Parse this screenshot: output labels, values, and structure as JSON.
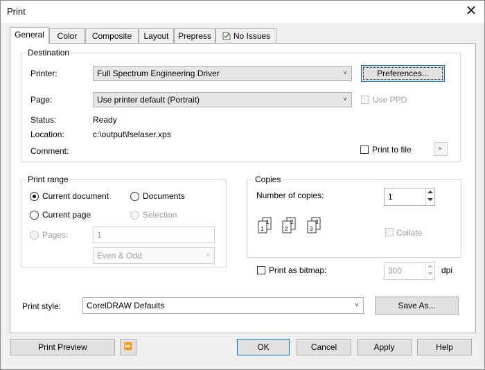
{
  "window": {
    "title": "Print",
    "close_glyph": "✕"
  },
  "tabs": [
    {
      "label": "General",
      "active": true
    },
    {
      "label": "Color"
    },
    {
      "label": "Composite"
    },
    {
      "label": "Layout"
    },
    {
      "label": "Prepress"
    },
    {
      "label": "No Issues",
      "icon": "check-doc-icon"
    }
  ],
  "destination": {
    "group_label": "Destination",
    "printer_label": "Printer:",
    "printer_value": "Full Spectrum Engineering Driver",
    "preferences_button": "Preferences...",
    "page_label": "Page:",
    "page_value": "Use printer default (Portrait)",
    "use_ppd_label": "Use PPD",
    "status_label": "Status:",
    "status_value": "Ready",
    "location_label": "Location:",
    "location_value": "c:\\output\\fselaser.xps",
    "comment_label": "Comment:",
    "print_to_file_label": "Print to file",
    "arrow_glyph": "▸"
  },
  "print_range": {
    "group_label": "Print range",
    "current_document": "Current document",
    "documents": "Documents",
    "current_page": "Current page",
    "selection": "Selection",
    "pages_label": "Pages:",
    "pages_value": "1",
    "subset_value": "Even & Odd"
  },
  "copies": {
    "group_label": "Copies",
    "number_label": "Number of copies:",
    "number_value": "1",
    "collate_label": "Collate"
  },
  "bitmap": {
    "label": "Print as bitmap:",
    "dpi_value": "300",
    "dpi_unit": "dpi"
  },
  "print_style": {
    "label": "Print style:",
    "value": "CorelDRAW Defaults",
    "save_as_button": "Save As..."
  },
  "footer": {
    "print_preview": "Print Preview",
    "preview_toggle_glyph": "⏩",
    "ok": "OK",
    "cancel": "Cancel",
    "apply": "Apply",
    "help": "Help"
  },
  "colors": {
    "focus_border": "#0078d7",
    "tab_panel_bg": "#ffffff",
    "dialog_bg": "#f0f0f0"
  }
}
